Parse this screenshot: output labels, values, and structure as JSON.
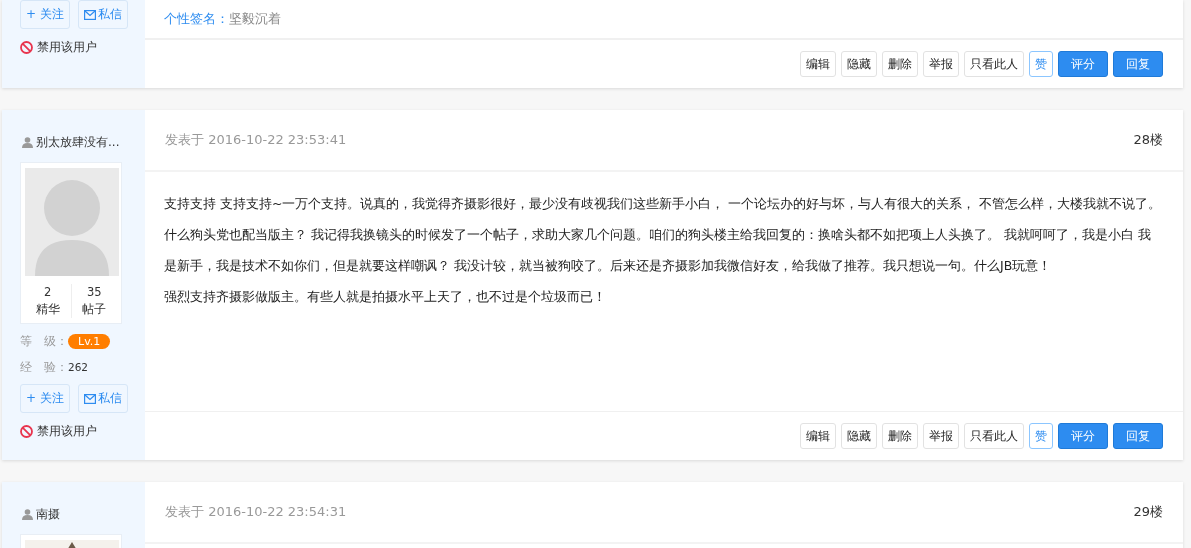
{
  "posts": [
    {
      "actions": {
        "follow": "+ 关注",
        "message": "私信",
        "ban": "禁用该用户"
      },
      "signature": {
        "label": "个性签名：",
        "value": "坚毅沉着"
      },
      "buttons": [
        {
          "label": "编辑",
          "kind": "plain"
        },
        {
          "label": "隐藏",
          "kind": "plain"
        },
        {
          "label": "删除",
          "kind": "plain"
        },
        {
          "label": "举报",
          "kind": "plain"
        },
        {
          "label": "只看此人",
          "kind": "plain"
        },
        {
          "label": "赞",
          "kind": "like"
        },
        {
          "label": "评分",
          "kind": "primary"
        },
        {
          "label": "回复",
          "kind": "primary"
        }
      ]
    },
    {
      "author": "别太放肆没有...",
      "avatar": {
        "kind": "placeholder"
      },
      "stats": [
        {
          "value": "2",
          "label": "精华"
        },
        {
          "value": "35",
          "label": "帖子"
        }
      ],
      "level_label": "等　级：",
      "level": "Lv.1",
      "exp_label": "经　验：",
      "exp": "262",
      "actions": {
        "follow": "+ 关注",
        "message": "私信",
        "ban": "禁用该用户"
      },
      "posted": "发表于 2016-10-22 23:53:41",
      "floor": "28楼",
      "paragraphs": [
        "支持支持 支持支持~一万个支持。说真的，我觉得齐摄影很好，最少没有歧视我们这些新手小白， 一个论坛办的好与坏，与人有很大的关系， 不管怎么样，大楼我就不说了。什么狗头党也配当版主？ 我记得我换镜头的时候发了一个帖子，求助大家几个问题。咱们的狗头楼主给我回复的：换啥头都不如把项上人头换了。 我就呵呵了，我是小白 我是新手，我是技术不如你们，但是就要这样嘲讽？ 我没计较，就当被狗咬了。后来还是齐摄影加我微信好友，给我做了推荐。我只想说一句。什么JB玩意！",
        "强烈支持齐摄影做版主。有些人就是拍摄水平上天了，也不过是个垃圾而已！"
      ],
      "buttons": [
        {
          "label": "编辑",
          "kind": "plain"
        },
        {
          "label": "隐藏",
          "kind": "plain"
        },
        {
          "label": "删除",
          "kind": "plain"
        },
        {
          "label": "举报",
          "kind": "plain"
        },
        {
          "label": "只看此人",
          "kind": "plain"
        },
        {
          "label": "赞",
          "kind": "like"
        },
        {
          "label": "评分",
          "kind": "primary"
        },
        {
          "label": "回复",
          "kind": "primary"
        }
      ]
    },
    {
      "author": "南摄",
      "posted": "发表于 2016-10-22 23:54:31",
      "floor": "29楼"
    }
  ]
}
